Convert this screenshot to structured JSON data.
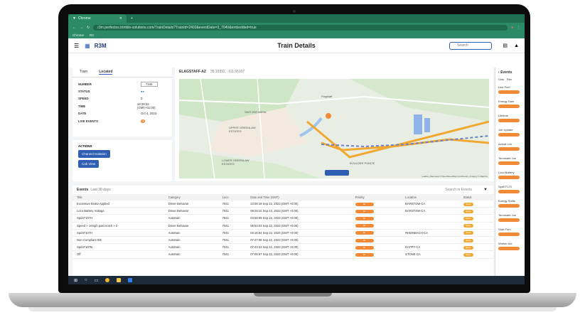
{
  "browser": {
    "tab_title": "Chrome",
    "url": "r3m.perfectos.trimble-solutions.com/TrainDetails?TrainId=2402&eventDate=3_7040&embedded=true",
    "bookmarks": [
      "Chrome",
      "R3"
    ]
  },
  "app": {
    "logo": "R3M",
    "title": "Train Details",
    "search_placeholder": "Search"
  },
  "left_panel": {
    "tabs": [
      "Train",
      "Located"
    ],
    "rows": [
      {
        "label": "NUMBER",
        "value": "7346"
      },
      {
        "label": "STATUS",
        "value": ""
      },
      {
        "label": "SPEED",
        "value": "0"
      },
      {
        "label": "TIME",
        "value": "19:39:52 (GMT+01:00)"
      },
      {
        "label": "DATE",
        "value": "Oct 4, 2023"
      },
      {
        "label": "LIVE EVENTS",
        "value": "3"
      }
    ]
  },
  "actions": {
    "title": "ACTIONS",
    "buttons": [
      "Channel Isolation",
      "Cab View"
    ]
  },
  "map": {
    "header": "ELAGSTAFF-AZ",
    "subheader": "35.19392, -111.65107",
    "places": [
      "Flagstaff",
      "SWITZER MESA",
      "UPPER GREENLAW ESTATES",
      "LOWER GREENLAW ESTATES",
      "BOULDER POINTE"
    ],
    "attribution": "Leaflet | Map data © OpenStreetMap contributors, Imagery © Mapbox"
  },
  "events": {
    "title": "Events",
    "count": "Last 30 days",
    "search_placeholder": "Search in Events",
    "columns": [
      "Title",
      "Category",
      "Loco",
      "Date and Time (GMT)",
      "Priority",
      "Location",
      "Status"
    ],
    "rows": [
      [
        "Excessive Brake Applied",
        "Driver Behavior",
        "7041",
        "23:08:19 Sep 22, 2023 (GMT +0:00)",
        "Hi",
        "BARSTOW-CA",
        "Open"
      ],
      [
        "Loco Battery Voltage",
        "Driver Behavior",
        "7041",
        "08:28:22 Sep 22, 2023 (GMT +0:00)",
        "Hi",
        "BARSTOW-CA",
        "Open"
      ],
      [
        "Spd47107H",
        "Autotrain",
        "7041",
        "04:58:09 Sep 22, 2023 (GMT +0:00)",
        "Hi",
        "",
        "Open"
      ],
      [
        "Speed > 10mph past notch > 0",
        "Driver Behavior",
        "7041",
        "06:53:03 Sep 22, 2023 (GMT +0:00)",
        "Hi",
        "",
        "Open"
      ],
      [
        "Spd47107H",
        "Autotrain",
        "7041",
        "03:16:54 Sep 22, 2023 (GMT +0:00)",
        "Hi",
        "RHEINBACH-CA",
        "Open"
      ],
      [
        "Non Compliant 0/E",
        "Autotrain",
        "7041",
        "07:47:08 Sep 22, 2023 (GMT +0:00)",
        "Hi",
        "",
        "Open"
      ],
      [
        "Spd47107B",
        "Autotrain",
        "7041",
        "07:43:43 Sep 22, 2023 (GMT +0:00)",
        "Hi",
        "DAPPY-CA",
        "Open"
      ],
      [
        "Off",
        "Autotrain",
        "7041",
        "07:06:57 Sep 22, 2023 (GMT +0:00)",
        "Hi",
        "STONE-CA",
        "Open"
      ]
    ]
  },
  "right_panel": {
    "title": "Events",
    "tabs": [
      "Ows",
      "Rec"
    ],
    "items": [
      "Line Fuel",
      "Energy Gain",
      "Lifetime",
      "Job Update",
      "Actuat Lim",
      "Terminate Jun",
      "Loco Battery",
      "SpdH7170",
      "Energy Shifts",
      "Terminate Jun",
      "Start Forn",
      "Worker Act"
    ]
  },
  "colors": {
    "browser_green": "#2c8a66",
    "primary_blue": "#2f5fb3",
    "event_orange": "#f08a36",
    "route_orange": "#f0a830"
  }
}
